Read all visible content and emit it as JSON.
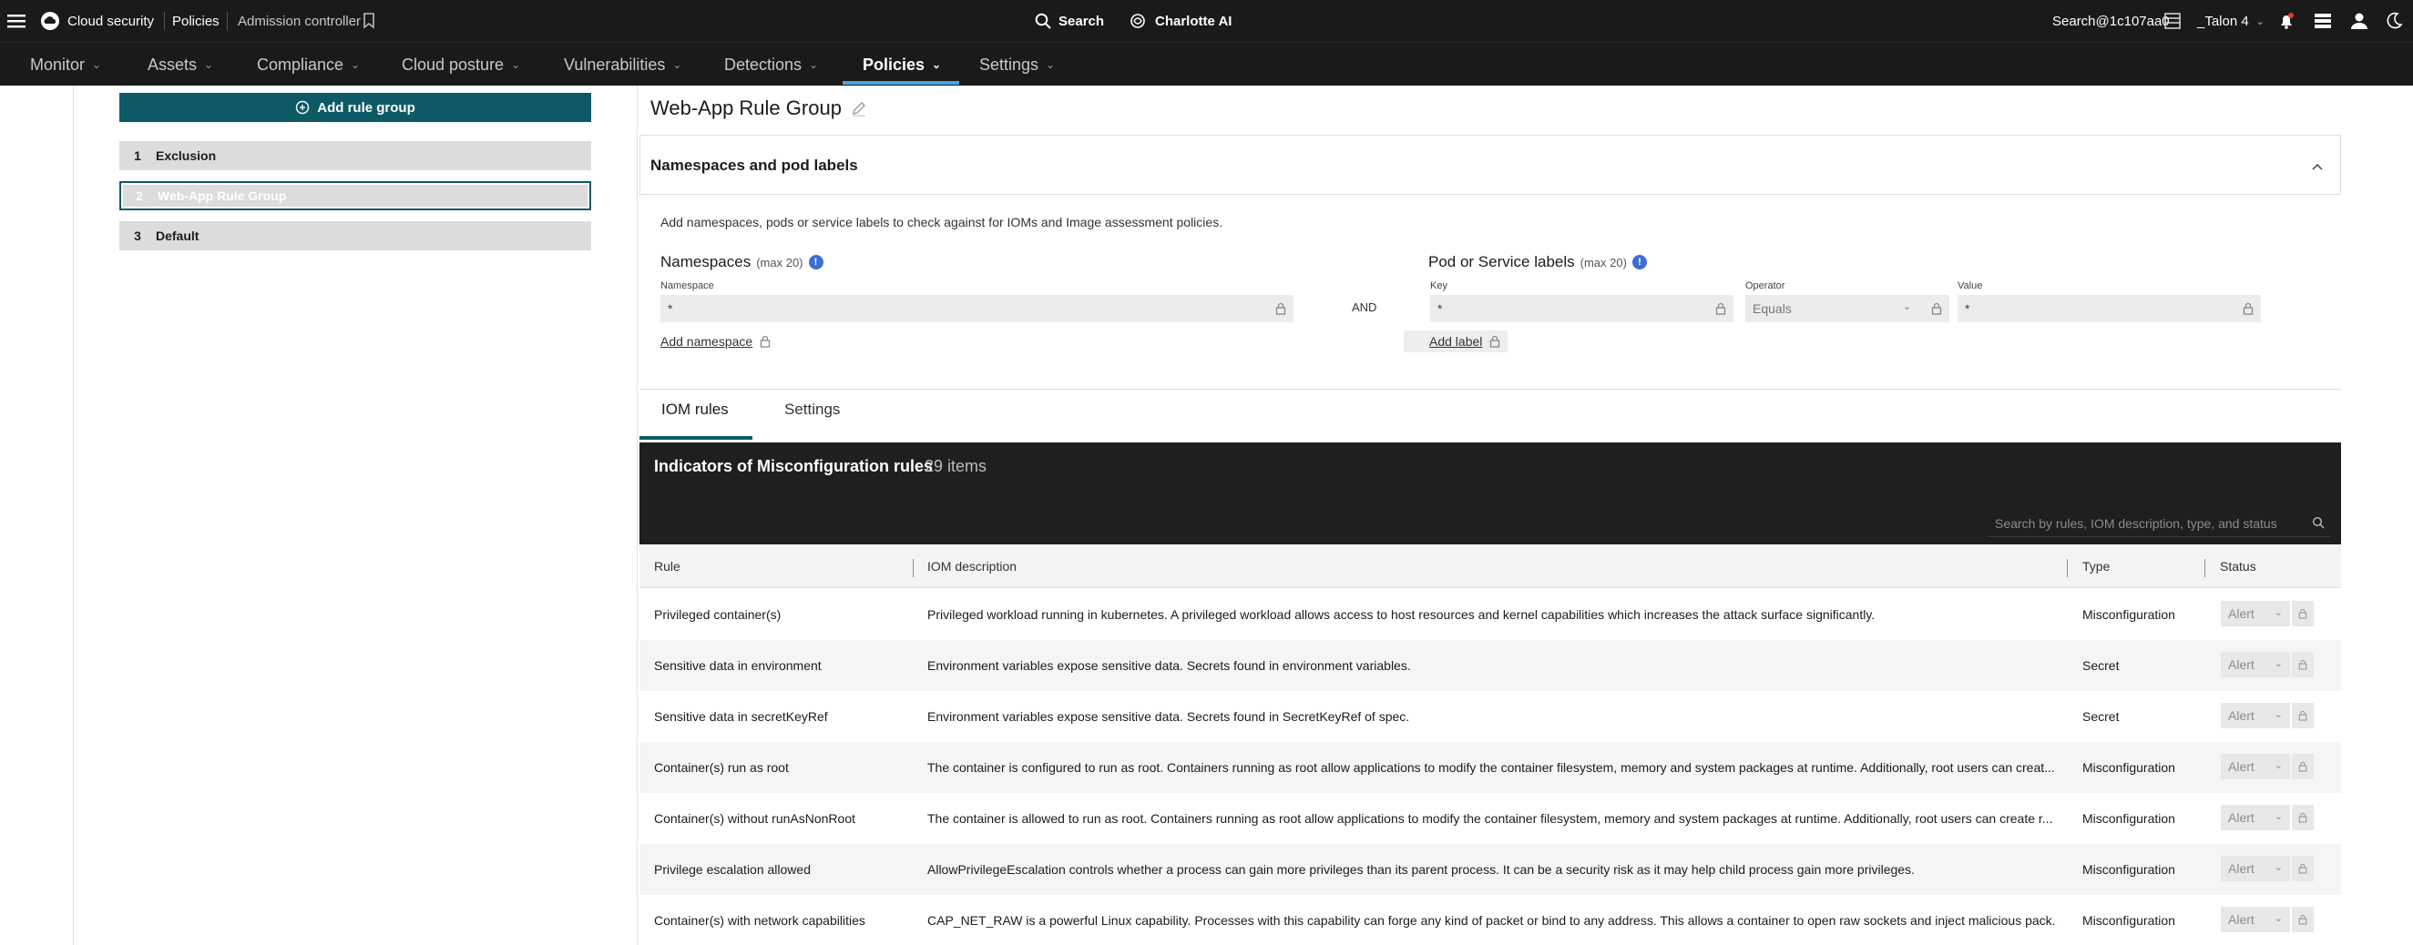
{
  "topbar": {
    "app_name": "Cloud security",
    "crumb_policies": "Policies",
    "crumb_admission": "Admission controller",
    "search_label": "Search",
    "charlotte_label": "Charlotte AI",
    "user_search": "Search@1c107aa0",
    "tenant": "_Talon 4"
  },
  "nav": {
    "items": [
      "Monitor",
      "Assets",
      "Compliance",
      "Cloud posture",
      "Vulnerabilities",
      "Detections",
      "Policies",
      "Settings"
    ],
    "active": "Policies"
  },
  "left": {
    "add_button": "Add rule group",
    "groups": [
      {
        "num": "1",
        "label": "Exclusion"
      },
      {
        "num": "2",
        "label": "Web-App Rule Group"
      },
      {
        "num": "3",
        "label": "Default"
      }
    ]
  },
  "rule_group": {
    "title": "Web-App Rule Group",
    "section_title": "Namespaces and pod labels",
    "help_text": "Add namespaces, pods or service labels to check against for IOMs and Image assessment policies.",
    "namespaces_label": "Namespaces",
    "namespaces_max": "(max 20)",
    "namespace_field_label": "Namespace",
    "namespace_value": "*",
    "add_namespace": "Add namespace",
    "and_label": "AND",
    "pod_labels_label": "Pod or Service labels",
    "pod_labels_max": "(max 20)",
    "key_label": "Key",
    "key_value": "*",
    "operator_label": "Operator",
    "operator_value": "Equals",
    "value_label": "Value",
    "value_value": "*",
    "add_label": "Add label"
  },
  "tabs": [
    "IOM rules",
    "Settings"
  ],
  "table": {
    "title": "Indicators of Misconfiguration rules",
    "count": "29 items",
    "search_placeholder": "Search by rules, IOM description, type, and status",
    "columns": [
      "Rule",
      "IOM description",
      "Type",
      "Status"
    ],
    "rows": [
      {
        "rule": "Privileged container(s)",
        "desc": "Privileged workload running in kubernetes. A privileged workload allows access to host resources and kernel capabilities which increases the attack surface significantly.",
        "type": "Misconfiguration",
        "status": "Alert"
      },
      {
        "rule": "Sensitive data in environment",
        "desc": "Environment variables expose sensitive data. Secrets found in environment variables.",
        "type": "Secret",
        "status": "Alert"
      },
      {
        "rule": "Sensitive data in secretKeyRef",
        "desc": "Environment variables expose sensitive data. Secrets found in SecretKeyRef of spec.",
        "type": "Secret",
        "status": "Alert"
      },
      {
        "rule": "Container(s) run as root",
        "desc": "The container is configured to run as root. Containers running as root allow applications to modify the container filesystem, memory and system packages at runtime. Additionally, root users can creat...",
        "type": "Misconfiguration",
        "status": "Alert"
      },
      {
        "rule": "Container(s) without runAsNonRoot",
        "desc": "The container is allowed to run as root. Containers running as root allow applications to modify the container filesystem, memory and system packages at runtime. Additionally, root users can create r...",
        "type": "Misconfiguration",
        "status": "Alert"
      },
      {
        "rule": "Privilege escalation allowed",
        "desc": "AllowPrivilegeEscalation controls whether a process can gain more privileges than its parent process. It can be a security risk as it may help child process gain more privileges.",
        "type": "Misconfiguration",
        "status": "Alert"
      },
      {
        "rule": "Container(s) with network capabilities",
        "desc": "CAP_NET_RAW is a powerful Linux capability. Processes with this capability can forge any kind of packet or bind to any address. This allows a container to open raw sockets and inject malicious pack...",
        "type": "Misconfiguration",
        "status": "Alert"
      }
    ]
  }
}
